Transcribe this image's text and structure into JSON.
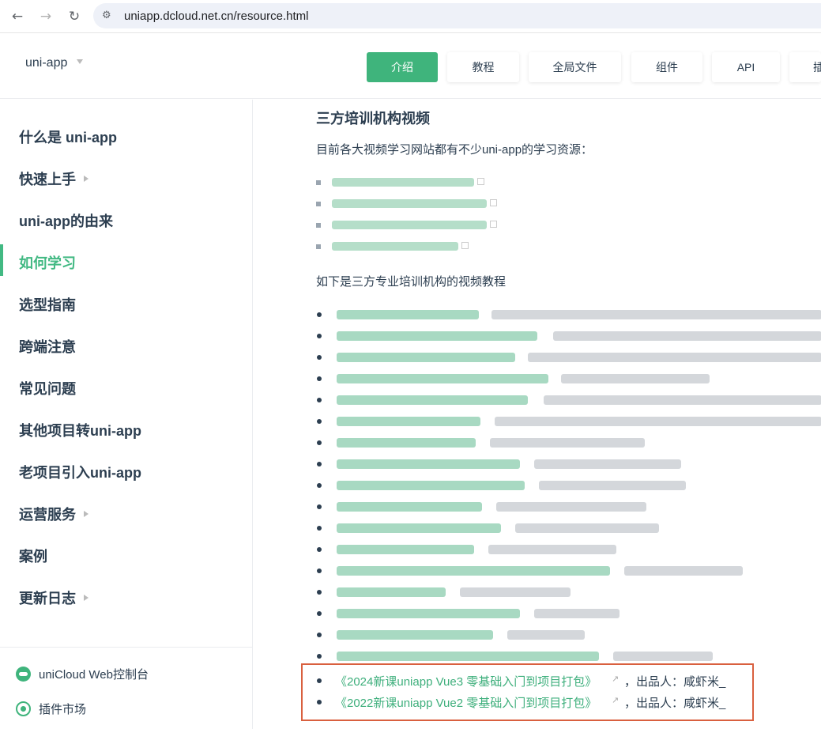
{
  "browser": {
    "url": "uniapp.dcloud.net.cn/resource.html",
    "back_icon": "arrow-left-icon",
    "forward_icon": "arrow-right-icon",
    "reload_icon": "reload-icon",
    "site_info_icon": "tune-icon"
  },
  "header": {
    "brand": "uni-app",
    "tabs": [
      {
        "label": "介绍",
        "active": true
      },
      {
        "label": "教程",
        "active": false
      },
      {
        "label": "全局文件",
        "active": false
      },
      {
        "label": "组件",
        "active": false
      },
      {
        "label": "API",
        "active": false
      },
      {
        "label": "插",
        "active": false
      }
    ],
    "accent_color": "#3fb47c"
  },
  "sidebar": {
    "items": [
      {
        "label": "什么是 uni-app",
        "expandable": false,
        "active": false
      },
      {
        "label": "快速上手",
        "expandable": true,
        "active": false
      },
      {
        "label": "uni-app的由来",
        "expandable": false,
        "active": false
      },
      {
        "label": "如何学习",
        "expandable": false,
        "active": true
      },
      {
        "label": "选型指南",
        "expandable": false,
        "active": false
      },
      {
        "label": "跨端注意",
        "expandable": false,
        "active": false
      },
      {
        "label": "常见问题",
        "expandable": false,
        "active": false
      },
      {
        "label": "其他项目转uni-app",
        "expandable": false,
        "active": false
      },
      {
        "label": "老项目引入uni-app",
        "expandable": false,
        "active": false
      },
      {
        "label": "运营服务",
        "expandable": true,
        "active": false
      },
      {
        "label": "案例",
        "expandable": false,
        "active": false
      },
      {
        "label": "更新日志",
        "expandable": true,
        "active": false
      }
    ],
    "footer": [
      {
        "label": "uniCloud Web控制台",
        "icon": "cloud-icon"
      },
      {
        "label": "插件市场",
        "icon": "plugin-icon"
      }
    ]
  },
  "content": {
    "heading": "三方培训机构视频",
    "intro": "目前各大视频学习网站都有不少uni-app的学习资源：",
    "list_intro": "如下是三方专业培训机构的视频教程",
    "highlighted_courses": [
      {
        "title": "《2024新课uniapp Vue3 零基础入门到项目打包》",
        "tail": "，出品人：咸虾米_"
      },
      {
        "title": "《2022新课uniapp Vue2 零基础入门到项目打包》",
        "tail": "，出品人：咸虾米_"
      }
    ],
    "link_color": "#3eaf7c",
    "highlight_border_color": "#d9603f"
  }
}
